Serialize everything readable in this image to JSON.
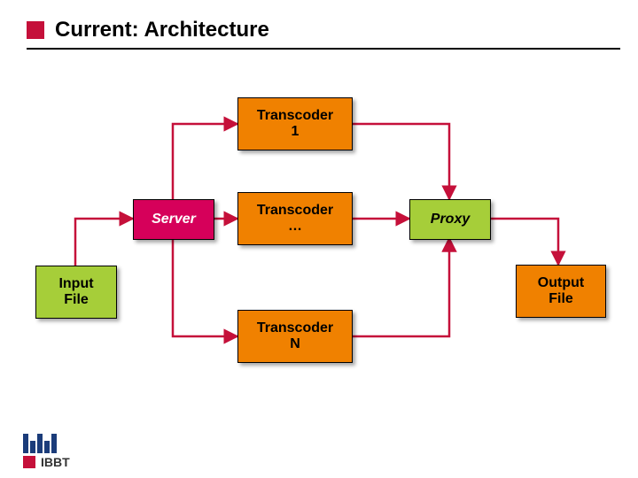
{
  "title": "Current: Architecture",
  "nodes": {
    "input_file": {
      "line1": "Input",
      "line2": "File"
    },
    "server": "Server",
    "transcoder1": {
      "line1": "Transcoder",
      "line2": "1"
    },
    "transcoderEllipsis": {
      "line1": "Transcoder",
      "line2": "…"
    },
    "transcoderN": {
      "line1": "Transcoder",
      "line2": "N"
    },
    "proxy": "Proxy",
    "output_file": {
      "line1": "Output",
      "line2": "File"
    }
  },
  "colors": {
    "accent_red": "#c5103a",
    "orange": "#f08100",
    "magenta": "#d6005a",
    "green": "#a6ce39",
    "arrow_red": "#c5103a"
  },
  "footer": {
    "org": "IBBT"
  },
  "edges": [
    {
      "from": "input_file",
      "to": "server"
    },
    {
      "from": "server",
      "to": "transcoder1"
    },
    {
      "from": "server",
      "to": "transcoderEllipsis"
    },
    {
      "from": "server",
      "to": "transcoderN"
    },
    {
      "from": "transcoder1",
      "to": "proxy"
    },
    {
      "from": "transcoderEllipsis",
      "to": "proxy"
    },
    {
      "from": "transcoderN",
      "to": "proxy"
    },
    {
      "from": "proxy",
      "to": "output_file"
    }
  ]
}
